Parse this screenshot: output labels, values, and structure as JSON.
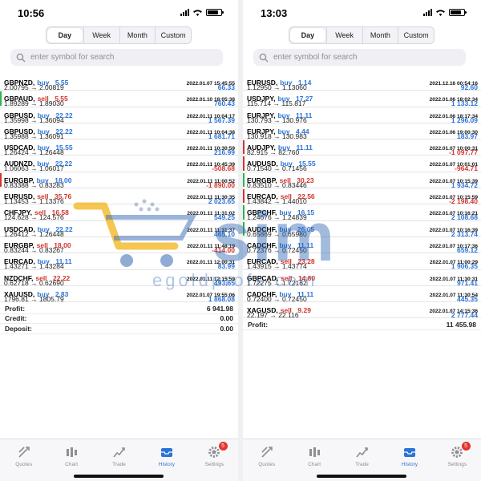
{
  "colors": {
    "buy": "#2a73d8",
    "sell": "#d2332c",
    "mark_green": "#2fb34a",
    "mark_red": "#d2332c",
    "badge": "#e5332a"
  },
  "periods": [
    "Day",
    "Week",
    "Month",
    "Custom"
  ],
  "search_placeholder": "enter symbol for search",
  "tabs": [
    {
      "label": "Quotes",
      "icon": "quotes-icon"
    },
    {
      "label": "Chart",
      "icon": "chart-icon"
    },
    {
      "label": "Trade",
      "icon": "trade-icon"
    },
    {
      "label": "History",
      "icon": "history-icon"
    },
    {
      "label": "Settings",
      "icon": "settings-icon",
      "badge": "5"
    }
  ],
  "watermark": {
    "text_main": "sim",
    "text_sub": "egoldprofx.com"
  },
  "left": {
    "time": "10:56",
    "active_tab": "History",
    "active_period": "Day",
    "trades": [
      {
        "symbol": "GBPNZD,",
        "side": "buy",
        "lots": "5.55",
        "time": "2022.01.07 15:45:55",
        "open": "2.00795",
        "close": "2.00819",
        "profit": "66.33",
        "mark": ""
      },
      {
        "symbol": "GBPAUD,",
        "side": "sell",
        "lots": "5.55",
        "time": "2022.01.10 18:05:38",
        "open": "1.89289",
        "close": "1.89030",
        "profit": "760.43",
        "mark": "green"
      },
      {
        "symbol": "GBPUSD,",
        "side": "buy",
        "lots": "22.22",
        "time": "2022.01.11 10:04:17",
        "open": "1.35998",
        "close": "1.36094",
        "profit": "1 567.39",
        "mark": ""
      },
      {
        "symbol": "GBPUSD,",
        "side": "buy",
        "lots": "22.22",
        "time": "2022.01.11 10:04:38",
        "open": "1.35988",
        "close": "1.36091",
        "profit": "1 681.71",
        "mark": ""
      },
      {
        "symbol": "USDCAD,",
        "side": "buy",
        "lots": "15.55",
        "time": "2022.01.11 10:30:59",
        "open": "1.26424",
        "close": "1.26448",
        "profit": "216.99",
        "mark": ""
      },
      {
        "symbol": "AUDNZD,",
        "side": "buy",
        "lots": "22.22",
        "time": "2022.01.11 10:45:39",
        "open": "1.06063",
        "close": "1.06017",
        "profit": "-508.68",
        "mark": ""
      },
      {
        "symbol": "EURGBP,",
        "side": "buy",
        "lots": "18.00",
        "time": "2022.01.11 11:00:52",
        "open": "0.83388",
        "close": "0.83283",
        "profit": "-1 890.00",
        "mark": "red"
      },
      {
        "symbol": "EURUSD,",
        "side": "sell",
        "lots": "35.76",
        "time": "2022.01.11 11:30:35",
        "open": "1.13453",
        "close": "1.13376",
        "profit": "2 023.65",
        "mark": ""
      },
      {
        "symbol": "CHFJPY,",
        "side": "sell",
        "lots": "16.58",
        "time": "2022.01.11 11:31:02",
        "open": "124.628",
        "close": "124.576",
        "profit": "549.25",
        "mark": ""
      },
      {
        "symbol": "USDCAD,",
        "side": "buy",
        "lots": "22.22",
        "time": "2022.01.11 11:31:37",
        "open": "1.26412",
        "close": "1.26448",
        "profit": "465.10",
        "mark": ""
      },
      {
        "symbol": "EURGBP,",
        "side": "sell",
        "lots": "18.00",
        "time": "2022.01.11 11:48:19",
        "open": "0.83244",
        "close": "0.83267",
        "profit": "-414.00",
        "mark": ""
      },
      {
        "symbol": "EURCAD,",
        "side": "buy",
        "lots": "11.11",
        "time": "2022.01.11 12:00:31",
        "open": "1.43271",
        "close": "1.43284",
        "profit": "83.99",
        "mark": ""
      },
      {
        "symbol": "NZDCHF,",
        "side": "sell",
        "lots": "22.22",
        "time": "2022.01.11 12:15:59",
        "open": "0.62718",
        "close": "0.62690",
        "profit": "493.65",
        "mark": ""
      },
      {
        "symbol": "XAUUSD,",
        "side": "buy",
        "lots": "2.83",
        "time": "2022.01.07 19:55:06",
        "open": "1796.81",
        "close": "1805.79",
        "profit": "1 868.08",
        "mark": ""
      }
    ],
    "summary": [
      {
        "label": "Profit:",
        "value": "6 941.98"
      },
      {
        "label": "Credit:",
        "value": "0.00"
      },
      {
        "label": "Deposit:",
        "value": "0.00"
      }
    ]
  },
  "right": {
    "time": "13:03",
    "active_tab": "History",
    "active_period": "Day",
    "trades": [
      {
        "symbol": "EURUSD,",
        "side": "buy",
        "lots": "1.14",
        "time": "2021.12.16 00:54:16",
        "open": "1.12950",
        "close": "1.13060",
        "profit": "92.60",
        "mark": ""
      },
      {
        "symbol": "USDJPY,",
        "side": "buy",
        "lots": "17.27",
        "time": "2022.01.06 18:02:34",
        "open": "115.714",
        "close": "115.817",
        "profit": "1 133.12",
        "mark": ""
      },
      {
        "symbol": "EURJPY,",
        "side": "buy",
        "lots": "11.11",
        "time": "2022.01.06 18:17:34",
        "open": "130.793",
        "close": "130.976",
        "profit": "1 296.09",
        "mark": ""
      },
      {
        "symbol": "EURJPY,",
        "side": "buy",
        "lots": "4.44",
        "time": "2022.01.06 19:00:30",
        "open": "130.918",
        "close": "130.983",
        "profit": "183.97",
        "mark": ""
      },
      {
        "symbol": "AUDJPY,",
        "side": "buy",
        "lots": "11.11",
        "time": "2022.01.07 10:00:31",
        "open": "82.915",
        "close": "82.760",
        "profit": "-1 097.77",
        "mark": "red"
      },
      {
        "symbol": "AUDUSD,",
        "side": "buy",
        "lots": "15.55",
        "time": "2022.01.07 10:01:01",
        "open": "0.71540",
        "close": "0.71456",
        "profit": "-964.71",
        "mark": "red"
      },
      {
        "symbol": "EURGBP,",
        "side": "sell",
        "lots": "30.23",
        "time": "2022.01.07 10:15:39",
        "open": "0.83510",
        "close": "0.83446",
        "profit": "1 934.72",
        "mark": "green"
      },
      {
        "symbol": "EURCAD,",
        "side": "sell",
        "lots": "22.56",
        "time": "2022.01.07 10:15:59",
        "open": "1.43842",
        "close": "1.44010",
        "profit": "-2 198.40",
        "mark": "red"
      },
      {
        "symbol": "GBPCHF,",
        "side": "buy",
        "lots": "16.15",
        "time": "2022.01.07 10:16:21",
        "open": "1.24676",
        "close": "1.24839",
        "profit": "2 108.68",
        "mark": "green"
      },
      {
        "symbol": "AUDCHF,",
        "side": "buy",
        "lots": "26.05",
        "time": "2022.01.07 10:16:39",
        "open": "0.65869",
        "close": "0.65980",
        "profit": "2 313.74",
        "mark": "green"
      },
      {
        "symbol": "CADCHF,",
        "side": "buy",
        "lots": "11.11",
        "time": "2022.01.07 10:17:36",
        "open": "0.72376",
        "close": "0.72450",
        "profit": "659.12",
        "mark": ""
      },
      {
        "symbol": "EURCAD,",
        "side": "sell",
        "lots": "23.28",
        "time": "2022.01.07 11:00:29",
        "open": "1.43915",
        "close": "1.43774",
        "profit": "1 906.35",
        "mark": ""
      },
      {
        "symbol": "GBPCAD,",
        "side": "sell",
        "lots": "14.80",
        "time": "2022.01.07 11:30:31",
        "open": "1.72275",
        "close": "1.72162",
        "profit": "971.41",
        "mark": ""
      },
      {
        "symbol": "CADCHF,",
        "side": "buy",
        "lots": "11.11",
        "time": "2022.01.07 11:30:54",
        "open": "0.72400",
        "close": "0.72450",
        "profit": "445.35",
        "mark": ""
      },
      {
        "symbol": "XAGUSD,",
        "side": "sell",
        "lots": "9.29",
        "time": "2022.01.07 14:15:36",
        "open": "22.197",
        "close": "22.116",
        "profit": "2 777.44",
        "mark": ""
      }
    ],
    "summary": [
      {
        "label": "Profit:",
        "value": "11 455.98"
      }
    ]
  }
}
